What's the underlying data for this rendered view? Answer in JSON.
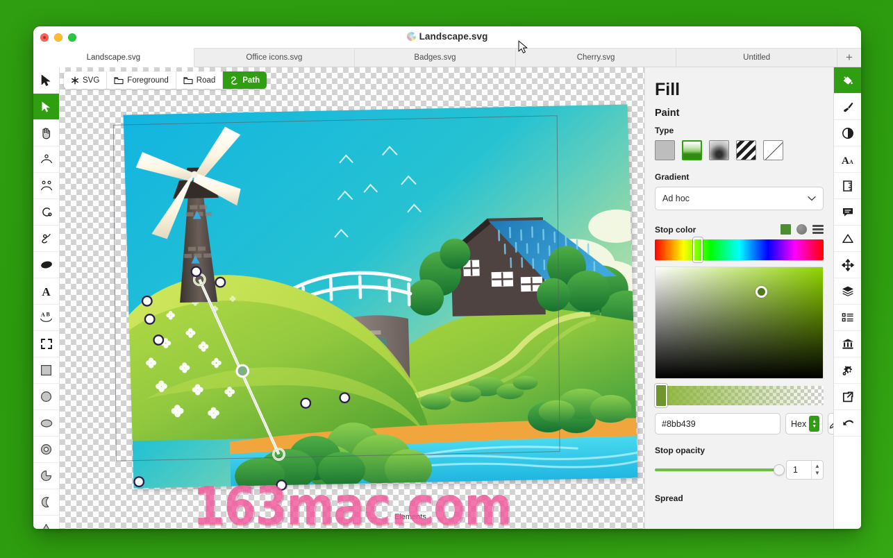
{
  "window": {
    "title": "Landscape.svg",
    "title_icon": "svg-file-icon",
    "controls": [
      "close",
      "minimize",
      "zoom"
    ]
  },
  "tabs": {
    "items": [
      {
        "label": "Landscape.svg",
        "active": true
      },
      {
        "label": "Office icons.svg",
        "active": false
      },
      {
        "label": "Badges.svg",
        "active": false
      },
      {
        "label": "Cherry.svg",
        "active": false
      },
      {
        "label": "Untitled",
        "active": false
      }
    ],
    "add_label": "+"
  },
  "breadcrumb": {
    "items": [
      {
        "label": "SVG",
        "icon": "asterisk-icon",
        "active": false
      },
      {
        "label": "Foreground",
        "icon": "folder-icon",
        "active": false
      },
      {
        "label": "Road",
        "icon": "folder-icon",
        "active": false
      },
      {
        "label": "Path",
        "icon": "path-icon",
        "active": true
      }
    ]
  },
  "left_toolbar": {
    "items": [
      {
        "name": "select-tool",
        "icon": "arrow-cursor-icon",
        "active": false
      },
      {
        "name": "node-tool",
        "icon": "node-arrow-icon",
        "active": true
      },
      {
        "name": "pan-tool",
        "icon": "hand-icon",
        "active": false
      },
      {
        "name": "node-edit-tool",
        "icon": "node-point-icon",
        "active": false
      },
      {
        "name": "multi-node-tool",
        "icon": "two-nodes-icon",
        "active": false
      },
      {
        "name": "curve-tool",
        "icon": "curve-icon",
        "active": false
      },
      {
        "name": "freehand-tool",
        "icon": "squiggle-icon",
        "active": false
      },
      {
        "name": "blob-tool",
        "icon": "filled-ellipse-icon",
        "active": false
      },
      {
        "name": "text-tool",
        "icon": "letter-a-icon",
        "active": false
      },
      {
        "name": "text-path-tool",
        "icon": "ab-curve-icon",
        "active": false
      },
      {
        "name": "crop-tool",
        "icon": "crop-frame-icon",
        "active": false
      },
      {
        "name": "rectangle-tool",
        "icon": "square-icon",
        "active": false
      },
      {
        "name": "circle-tool",
        "icon": "circle-icon",
        "active": false
      },
      {
        "name": "ellipse-tool",
        "icon": "ellipse-icon",
        "active": false
      },
      {
        "name": "donut-tool",
        "icon": "donut-icon",
        "active": false
      },
      {
        "name": "pie-tool",
        "icon": "pie-icon",
        "active": false
      },
      {
        "name": "moon-tool",
        "icon": "crescent-moon-icon",
        "active": false
      },
      {
        "name": "triangle-tool",
        "icon": "triangle-icon",
        "active": false
      }
    ]
  },
  "right_toolbar": {
    "items": [
      {
        "name": "fill-panel",
        "icon": "paint-bucket-icon",
        "active": true
      },
      {
        "name": "stroke-panel",
        "icon": "paintbrush-icon",
        "active": false
      },
      {
        "name": "effects-panel",
        "icon": "contrast-circle-icon",
        "active": false
      },
      {
        "name": "typography-panel",
        "icon": "font-aa-icon",
        "active": false
      },
      {
        "name": "measure-panel",
        "icon": "ruler-icon",
        "active": false
      },
      {
        "name": "comments-panel",
        "icon": "speech-bubble-icon",
        "active": false
      },
      {
        "name": "geometry-panel",
        "icon": "triangle-outline-icon",
        "active": false
      },
      {
        "name": "transform-panel",
        "icon": "move-arrows-icon",
        "active": false
      },
      {
        "name": "layers-panel",
        "icon": "layers-stack-icon",
        "active": false
      },
      {
        "name": "elements-panel",
        "icon": "list-icon",
        "active": false
      },
      {
        "name": "library-panel",
        "icon": "bank-columns-icon",
        "active": false
      },
      {
        "name": "settings-panel",
        "icon": "gears-icon",
        "active": false
      },
      {
        "name": "export-panel",
        "icon": "export-arrow-icon",
        "active": false
      },
      {
        "name": "undo-panel",
        "icon": "undo-arrow-icon",
        "active": false
      }
    ]
  },
  "fill_panel": {
    "title": "Fill",
    "paint_heading": "Paint",
    "type_label": "Type",
    "types": [
      {
        "name": "solid",
        "selected": false
      },
      {
        "name": "linear-gradient",
        "selected": true
      },
      {
        "name": "radial-gradient",
        "selected": false
      },
      {
        "name": "pattern",
        "selected": false
      },
      {
        "name": "none",
        "selected": false
      }
    ],
    "gradient_label": "Gradient",
    "gradient_value": "Ad hoc",
    "stop_color_label": "Stop color",
    "stop_color_modes": [
      "square-swatch",
      "circle-swatch",
      "list-swatch"
    ],
    "hex_value": "#8bb439",
    "color_mode": "Hex",
    "eyedropper": "eyedropper-icon",
    "stop_opacity_label": "Stop opacity",
    "stop_opacity_value": "1",
    "spread_label": "Spread",
    "accent_color": "#2f9e10",
    "stop_color_hex": "#8bb439"
  },
  "canvas": {
    "elements_tooltip": "Elements",
    "watermark": "163mac.com",
    "artwork_name": "landscape-illustration",
    "background": "transparent-checkerboard"
  }
}
